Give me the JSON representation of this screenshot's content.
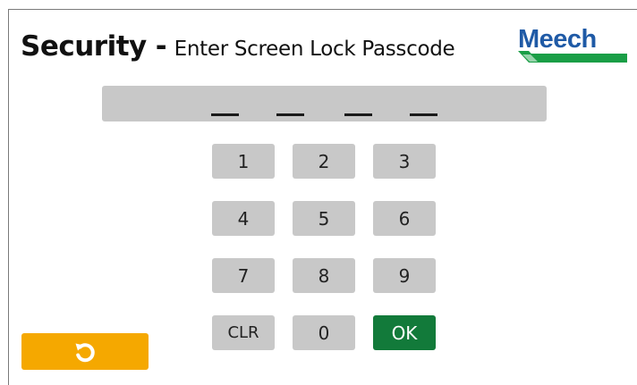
{
  "header": {
    "title": "Security",
    "separator": "-",
    "subtitle": "Enter Screen Lock Passcode"
  },
  "logo": {
    "text": "Meech",
    "brand_color": "#1f5aa6",
    "stripe_color": "#1a9e46"
  },
  "passcode": {
    "digit_slots": 4,
    "entered": ""
  },
  "keypad": {
    "keys": [
      "1",
      "2",
      "3",
      "4",
      "5",
      "6",
      "7",
      "8",
      "9",
      "CLR",
      "0",
      "OK"
    ],
    "key_color": "#c8c8c8",
    "ok_color": "#127a3a"
  },
  "back_button": {
    "icon": "undo-icon",
    "color": "#f5a800"
  }
}
